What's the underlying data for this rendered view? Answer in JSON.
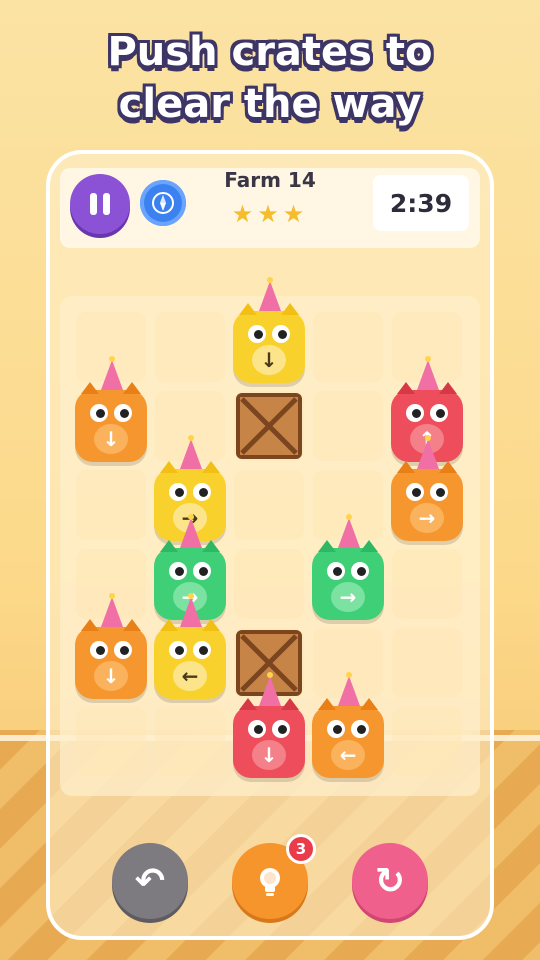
{
  "headline": {
    "line1": "Push crates to",
    "line2": "clear the way"
  },
  "hud": {
    "level_name": "Farm 14",
    "stars": "★★★",
    "timer": "2:39",
    "icons": {
      "pause": "pause-icon",
      "compass": "compass-icon"
    }
  },
  "controls": {
    "hint_count": "3",
    "undo_glyph": "↶",
    "hint_glyph": "💡",
    "restart_glyph": "↻"
  },
  "colors": {
    "yellow": "#f9d12c",
    "orange": "#f6962e",
    "red": "#ee4d5b",
    "green": "#3fcf76",
    "crate": "#b87438"
  },
  "board": {
    "columns": 5,
    "rows": 6,
    "pieces": [
      {
        "kind": "creature",
        "color": "yellow",
        "col": 2,
        "row": 0,
        "arrow": "↓",
        "hat": true
      },
      {
        "kind": "creature",
        "color": "orange",
        "col": 0,
        "row": 1,
        "arrow": "↓",
        "hat": true
      },
      {
        "kind": "crate",
        "col": 2,
        "row": 1
      },
      {
        "kind": "creature",
        "color": "red",
        "col": 4,
        "row": 1,
        "arrow": "↑",
        "hat": true
      },
      {
        "kind": "creature",
        "color": "yellow",
        "col": 1,
        "row": 2,
        "arrow": "→",
        "hat": true
      },
      {
        "kind": "creature",
        "color": "orange",
        "col": 4,
        "row": 2,
        "arrow": "→",
        "hat": true
      },
      {
        "kind": "creature",
        "color": "green",
        "col": 1,
        "row": 3,
        "arrow": "→",
        "hat": true
      },
      {
        "kind": "creature",
        "color": "green",
        "col": 3,
        "row": 3,
        "arrow": "→",
        "hat": true
      },
      {
        "kind": "creature",
        "color": "orange",
        "col": 0,
        "row": 4,
        "arrow": "↓",
        "hat": true
      },
      {
        "kind": "creature",
        "color": "yellow",
        "col": 1,
        "row": 4,
        "arrow": "←",
        "hat": true
      },
      {
        "kind": "crate",
        "col": 2,
        "row": 4
      },
      {
        "kind": "creature",
        "color": "red",
        "col": 2,
        "row": 5,
        "arrow": "↓",
        "hat": true
      },
      {
        "kind": "creature",
        "color": "orange",
        "col": 3,
        "row": 5,
        "arrow": "←",
        "hat": true
      }
    ]
  }
}
